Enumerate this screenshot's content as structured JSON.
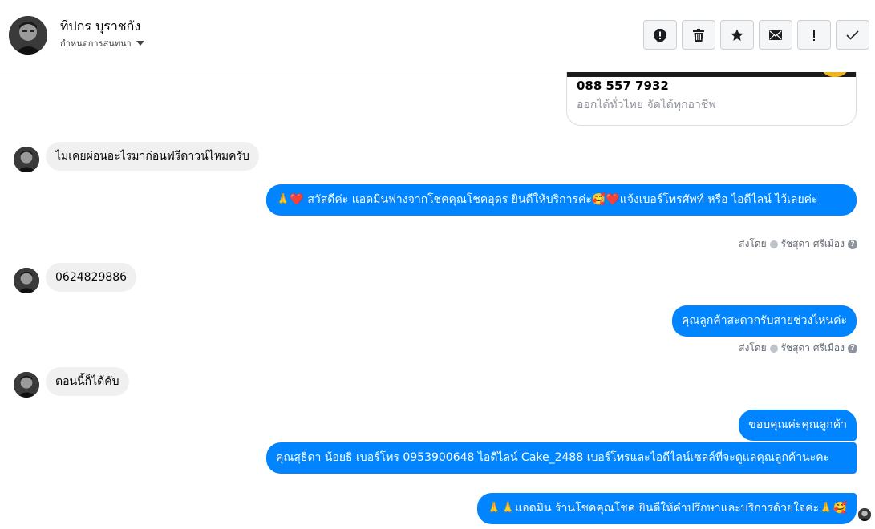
{
  "header": {
    "contact_name": "ทีปกร บุราชกัง",
    "subtitle": "กำหนดการสนทนา",
    "actions": [
      {
        "name": "report-icon",
        "label": "!"
      },
      {
        "name": "trash-icon",
        "label": "delete"
      },
      {
        "name": "star-icon",
        "label": "star"
      },
      {
        "name": "envelope-icon",
        "label": "mark-unread"
      },
      {
        "name": "exclamation-icon",
        "label": "!"
      },
      {
        "name": "checkmark-icon",
        "label": "done"
      }
    ]
  },
  "card": {
    "phone": "088 557 7932",
    "description": "ออกได้ทั่วไทย จัดได้ทุกอาชีพ"
  },
  "messages": {
    "m1": "ไม่เคยผ่อนอะไรมาก่อนฟรีดาวน์ไหมครับ",
    "m2": "🙏❤️ สวัสดีค่ะ แอดมินฟางจากโชคคุณโชคอุดร ยินดีให้บริการค่ะ🥰❤️แจ้งเบอร์โทรศัพท์ หรือ ไอดีไลน์  ไว้เลยค่ะ",
    "m3": "0624829886",
    "m4": "คุณลูกค้าสะดวกรับสายช่วงไหนค่ะ",
    "m5": "ตอนนี้ก็ได้คับ",
    "m6": "ขอบคุณค่ะคุณลูกค้า",
    "m7": "คุณสุธิดา น้อยธิ      เบอร์โทร 0953900648  ไอดีไลน์ Cake_2488   เบอร์โทรและไอดีไลน์เซลล์ที่จะดูแลคุณลูกค้านะคะ",
    "m8": "🙏🙏แอดมิน ร้านโชคคุณโชค ยินดีให้คำปรึกษาและบริการด้วยใจค่ะ🙏🥰"
  },
  "sent_by": {
    "prefix": "ส่งโดย",
    "agent": "รัชสุดา ศรีเมือง",
    "help": "?"
  },
  "colors": {
    "outgoing": "#0084ff",
    "incoming": "#f0f0f0"
  }
}
